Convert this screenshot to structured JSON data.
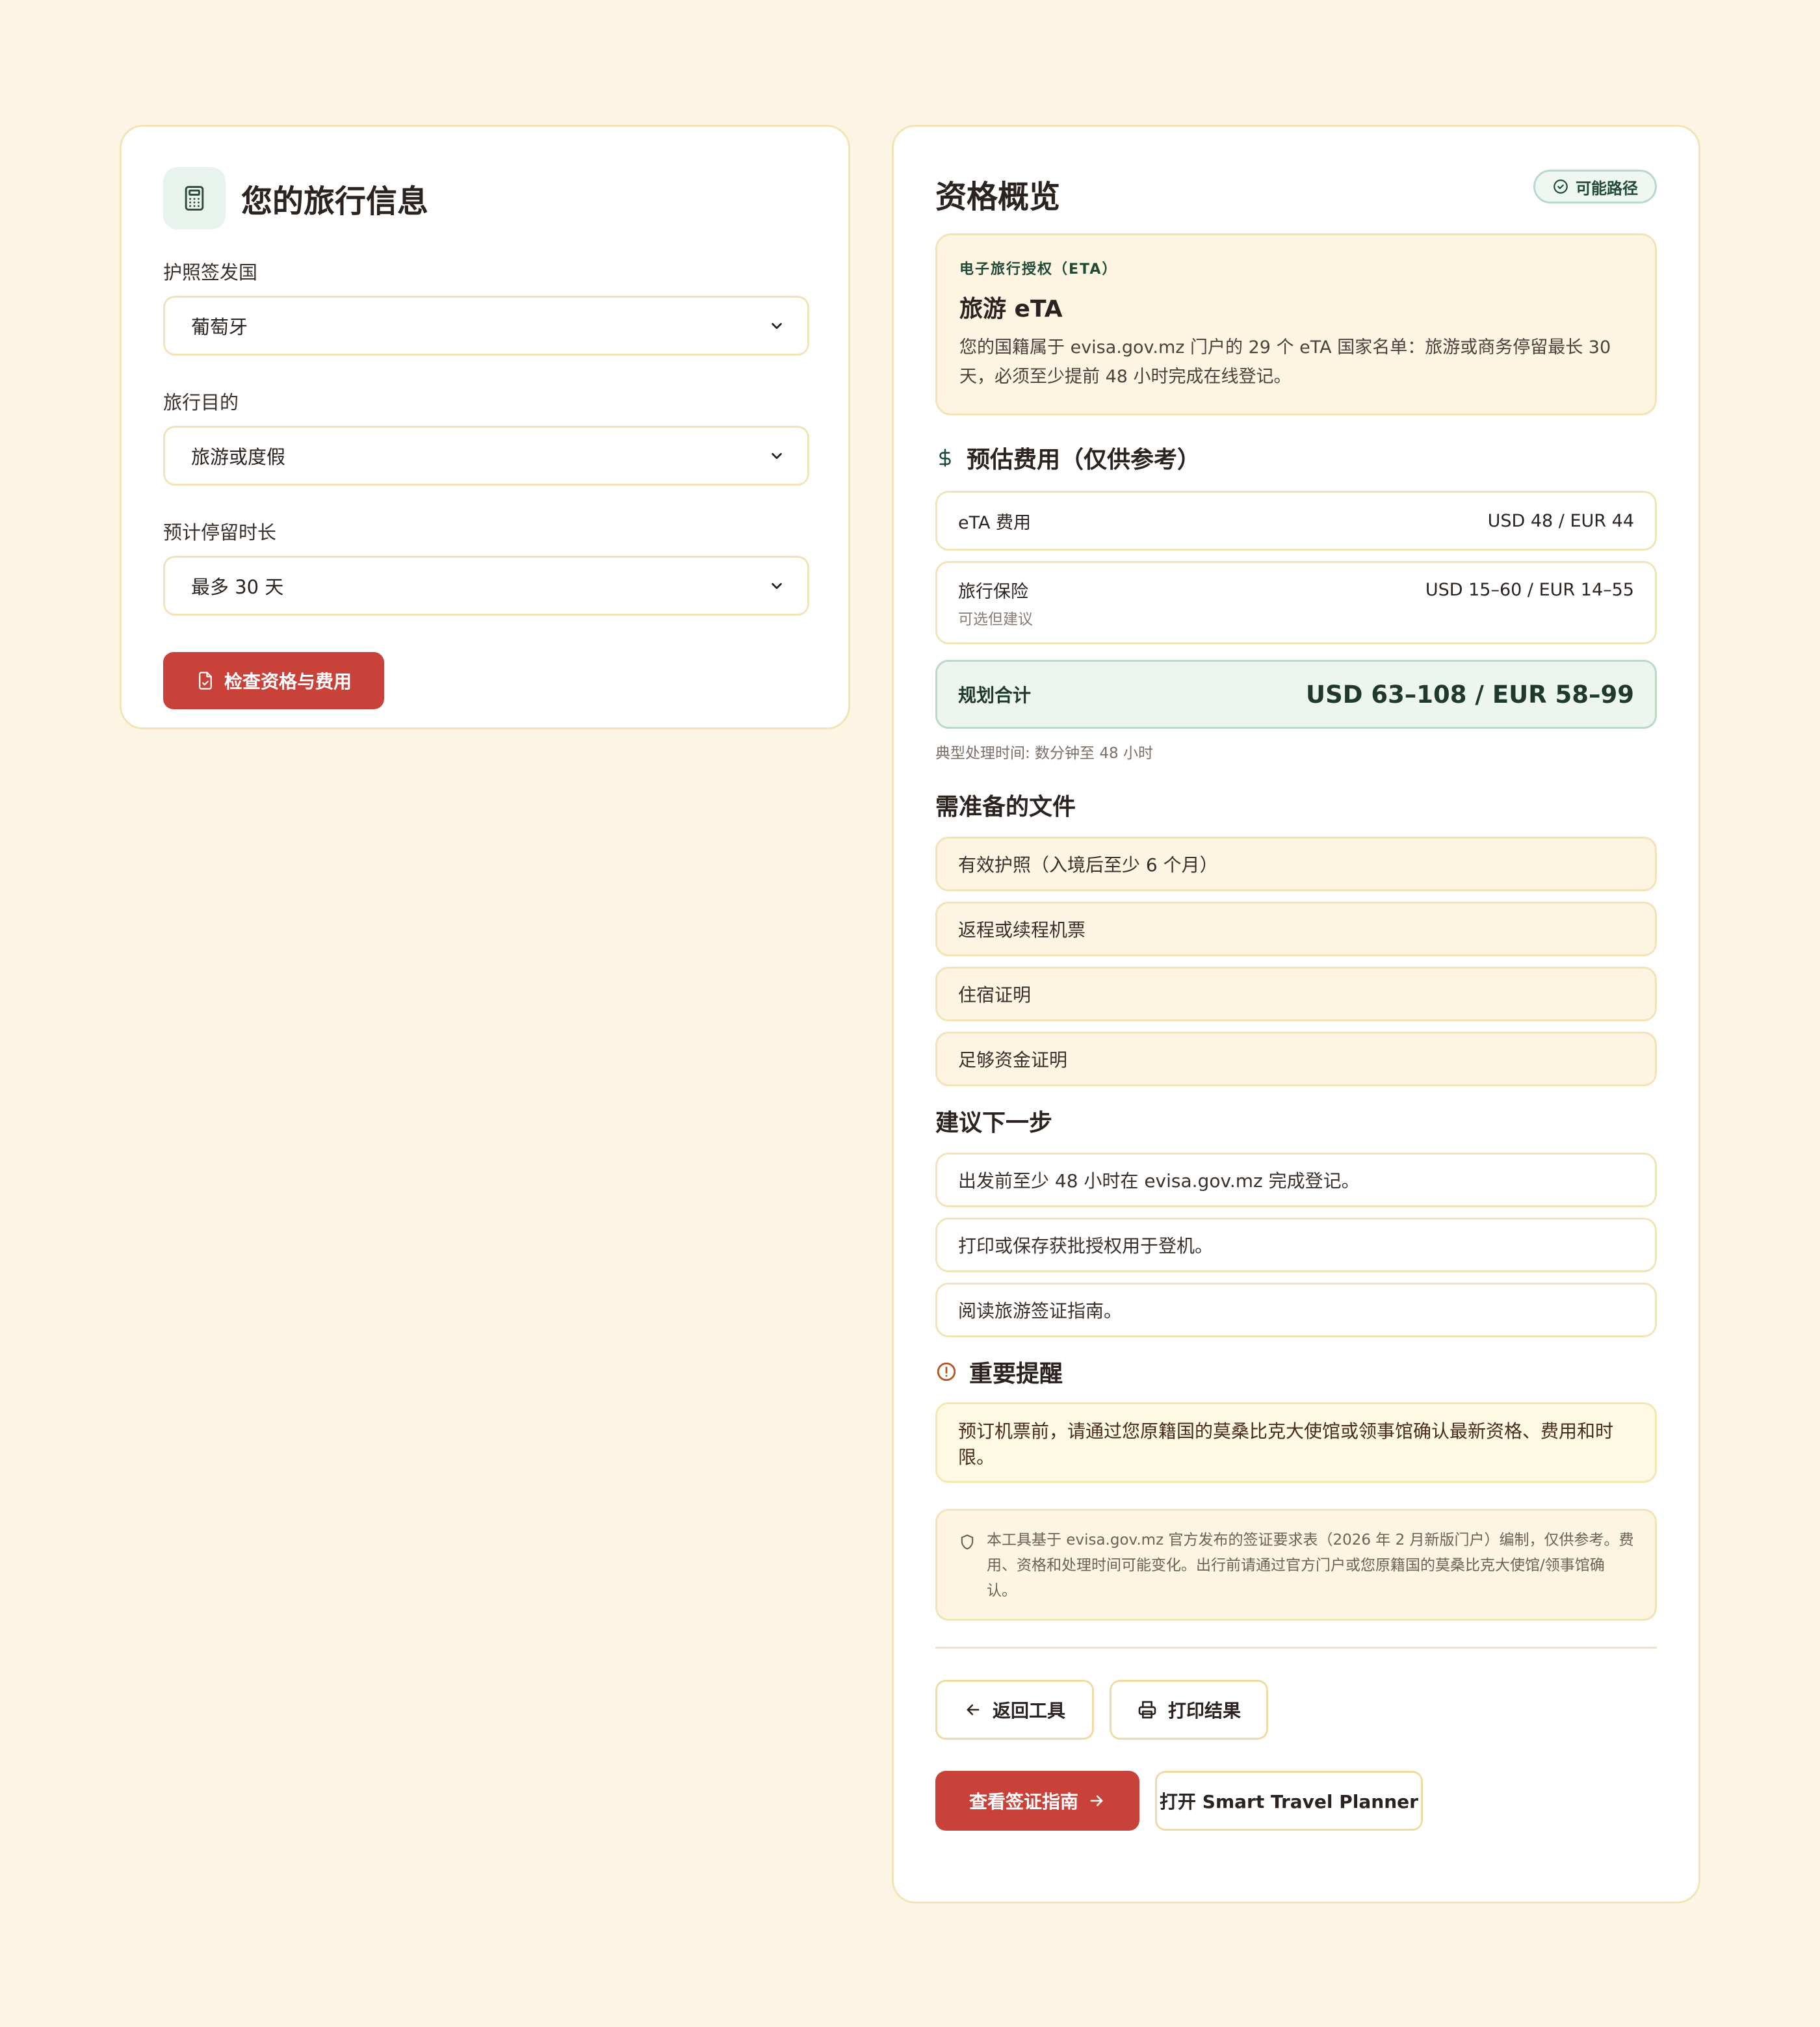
{
  "form": {
    "title": "您的旅行信息",
    "passport_label": "护照签发国",
    "passport_value": "葡萄牙",
    "purpose_label": "旅行目的",
    "purpose_value": "旅游或度假",
    "duration_label": "预计停留时长",
    "duration_value": "最多 30 天",
    "submit_label": "检查资格与费用"
  },
  "overview": {
    "title": "资格概览",
    "status_badge": "可能路径",
    "eta": {
      "kicker": "电子旅行授权（ETA）",
      "name": "旅游 eTA",
      "description": "您的国籍属于 evisa.gov.mz 门户的 29 个 eTA 国家名单：旅游或商务停留最长 30 天，必须至少提前 48 小时完成在线登记。"
    }
  },
  "costs": {
    "title": "预估费用（仅供参考）",
    "items": [
      {
        "label": "eTA 费用",
        "sublabel": "",
        "value": "USD 48 / EUR 44"
      },
      {
        "label": "旅行保险",
        "sublabel": "可选但建议",
        "value": "USD 15–60 / EUR 14–55"
      }
    ],
    "total_label": "规划合计",
    "total_value": "USD 63–108 / EUR 58–99",
    "processing": "典型处理时间: 数分钟至 48 小时"
  },
  "documents": {
    "title": "需准备的文件",
    "items": [
      "有效护照（入境后至少 6 个月）",
      "返程或续程机票",
      "住宿证明",
      "足够资金证明"
    ]
  },
  "next_steps": {
    "title": "建议下一步",
    "items": [
      "出发前至少 48 小时在 evisa.gov.mz 完成登记。",
      "打印或保存获批授权用于登机。",
      "阅读旅游签证指南。"
    ]
  },
  "reminder": {
    "title": "重要提醒",
    "text": "预订机票前，请通过您原籍国的莫桑比克大使馆或领事馆确认最新资格、费用和时限。"
  },
  "disclaimer": {
    "text": "本工具基于 evisa.gov.mz 官方发布的签证要求表（2026 年 2 月新版门户）编制，仅供参考。费用、资格和处理时间可能变化。出行前请通过官方门户或您原籍国的莫桑比克大使馆/领事馆确认。"
  },
  "actions": {
    "back_label": "返回工具",
    "print_label": "打印结果",
    "guide_label": "查看签证指南",
    "planner_label": "打开 Smart Travel Planner"
  },
  "colors": {
    "accent": "#c9423a",
    "background": "#fdf5e4",
    "border": "#f2e4b8",
    "success": "#1f4a35"
  }
}
